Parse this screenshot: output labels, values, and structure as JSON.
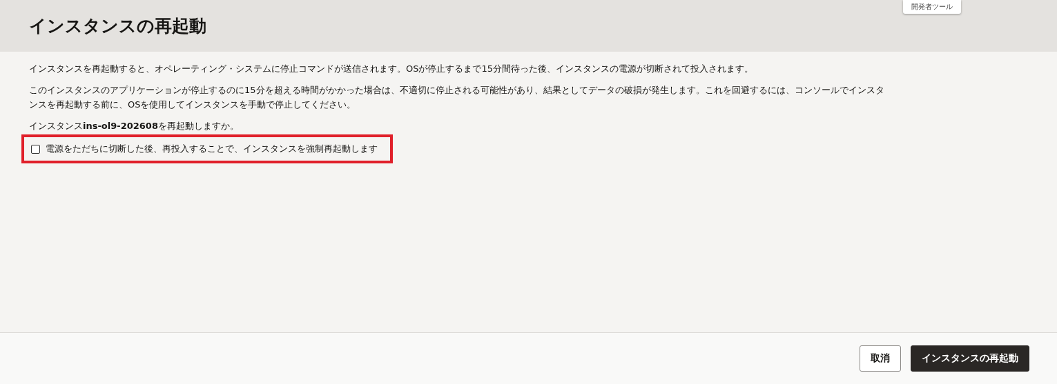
{
  "tooltip": {
    "text": "開発者ツール"
  },
  "dialog": {
    "title": "インスタンスの再起動",
    "paragraphs": [
      "インスタンスを再起動すると、オペレーティング・システムに停止コマンドが送信されます。OSが停止するまで15分間待った後、インスタンスの電源が切断されて投入されます。",
      "このインスタンスのアプリケーションが停止するのに15分を超える時間がかかった場合は、不適切に停止される可能性があり、結果としてデータの破損が発生します。これを回避するには、コンソールでインスタンスを再起動する前に、OSを使用してインスタンスを手動で停止してください。"
    ],
    "question": "インスタンス**ins-ol9-202608**を再起動しますか。",
    "checkbox": {
      "label": "電源をただちに切断した後、再投入することで、インスタンスを強制再起動します",
      "checked": false,
      "highlighted": true
    },
    "buttons": [
      {
        "label": "取消",
        "kind": "secondary"
      },
      {
        "label": "インスタンスの再起動",
        "kind": "primary"
      }
    ]
  }
}
